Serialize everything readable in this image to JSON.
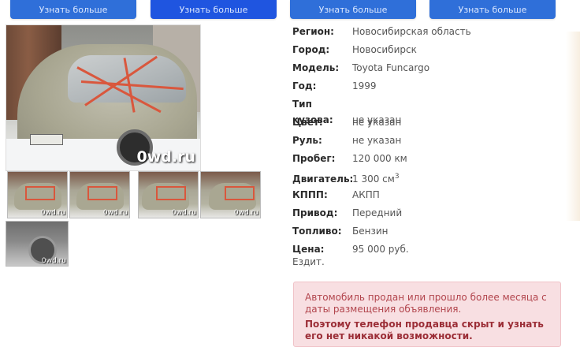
{
  "top_buttons": [
    {
      "label": "Узнать больше"
    },
    {
      "label": "Узнать больше"
    },
    {
      "label": "Узнать больше"
    },
    {
      "label": "Узнать больше"
    }
  ],
  "photo": {
    "watermark": "0wd.ru",
    "thumb_watermark": "0wd.ru"
  },
  "specs": [
    {
      "key": "Регион:",
      "value": "Новосибирская область"
    },
    {
      "key": "Город:",
      "value": "Новосибирск"
    },
    {
      "key": "Модель:",
      "value": "Toyota Funcargo"
    },
    {
      "key": "Год:",
      "value": "1999"
    },
    {
      "key": "Тип кузова:",
      "value": "не указан"
    },
    {
      "key": "Цвет:",
      "value": "не указан"
    },
    {
      "key": "Руль:",
      "value": "не указан"
    },
    {
      "key": "Пробег:",
      "value": "120 000 км"
    },
    {
      "key": "Двигатель:",
      "value": "1 300 см",
      "sup": "3"
    },
    {
      "key": "КППП:",
      "value": "АКПП"
    },
    {
      "key": "Привод:",
      "value": "Передний"
    },
    {
      "key": "Топливо:",
      "value": "Бензин"
    },
    {
      "key": "Цена:",
      "value": "95 000 руб."
    }
  ],
  "note": "Ездит.",
  "alert": {
    "text": "Автомобиль продан или прошло более месяца с даты размещения объявления.",
    "strong": "Поэтому телефон продавца скрыт и узнать его нет никакой возможности."
  }
}
